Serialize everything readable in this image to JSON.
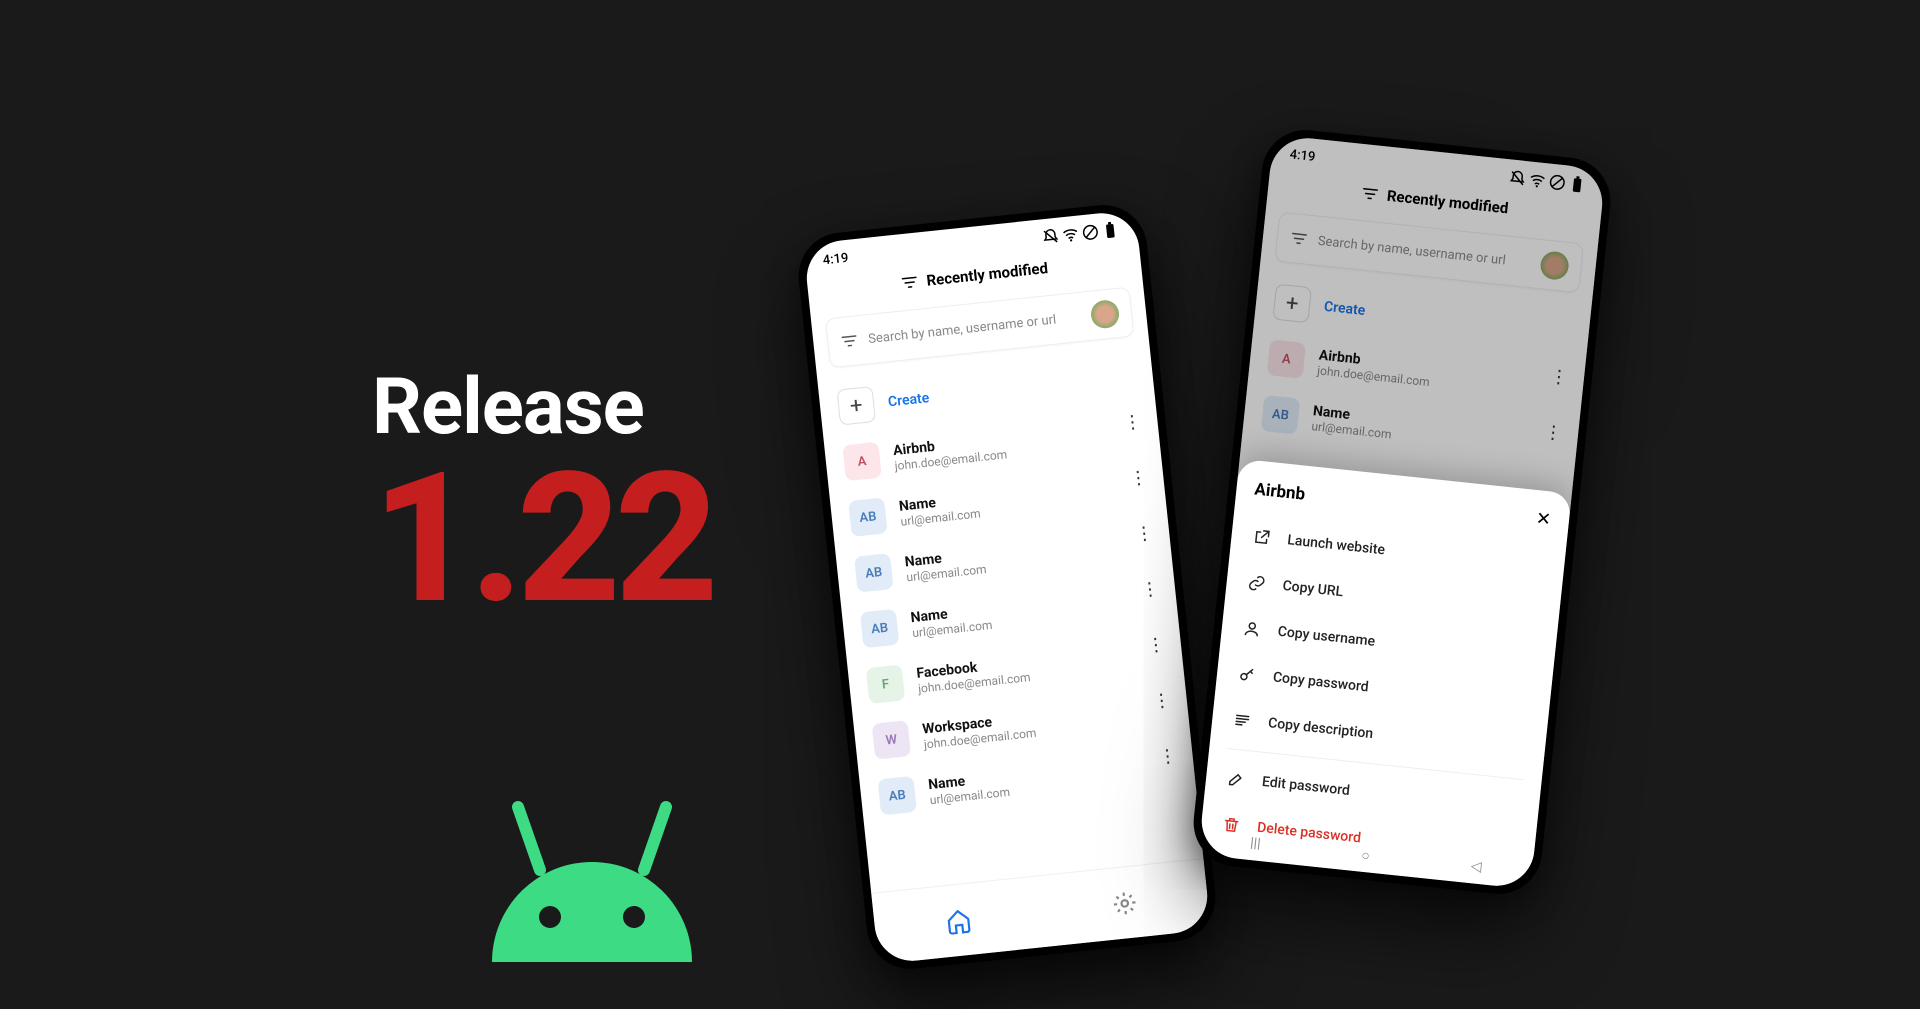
{
  "headline": {
    "word": "Release",
    "version": "1.22"
  },
  "status": {
    "time": "4:19"
  },
  "header": {
    "sort_label": "Recently modified"
  },
  "search": {
    "placeholder": "Search by name, username or url"
  },
  "create_label": "Create",
  "items": [
    {
      "badge": "A",
      "badge_class": "b-pink",
      "title": "Airbnb",
      "sub": "john.doe@email.com"
    },
    {
      "badge": "AB",
      "badge_class": "b-blue",
      "title": "Name",
      "sub": "url@email.com"
    },
    {
      "badge": "AB",
      "badge_class": "b-blue",
      "title": "Name",
      "sub": "url@email.com"
    },
    {
      "badge": "AB",
      "badge_class": "b-blue",
      "title": "Name",
      "sub": "url@email.com"
    },
    {
      "badge": "F",
      "badge_class": "b-green",
      "title": "Facebook",
      "sub": "john.doe@email.com"
    },
    {
      "badge": "W",
      "badge_class": "b-purple",
      "title": "Workspace",
      "sub": "john.doe@email.com"
    },
    {
      "badge": "AB",
      "badge_class": "b-blue",
      "title": "Name",
      "sub": "url@email.com"
    }
  ],
  "right_phone_items": [
    {
      "badge": "A",
      "badge_class": "b-pink",
      "title": "Airbnb",
      "sub": "john.doe@email.com"
    },
    {
      "badge": "AB",
      "badge_class": "b-blue",
      "title": "Name",
      "sub": "url@email.com"
    }
  ],
  "sheet": {
    "title": "Airbnb",
    "actions": {
      "launch": "Launch website",
      "copy_url": "Copy URL",
      "copy_username": "Copy username",
      "copy_password": "Copy password",
      "copy_description": "Copy description",
      "edit": "Edit password",
      "delete": "Delete password"
    }
  },
  "colors": {
    "accent_red": "#c41e1e",
    "link_blue": "#1a73e8",
    "danger": "#d93025",
    "android_green": "#3ddc84"
  }
}
